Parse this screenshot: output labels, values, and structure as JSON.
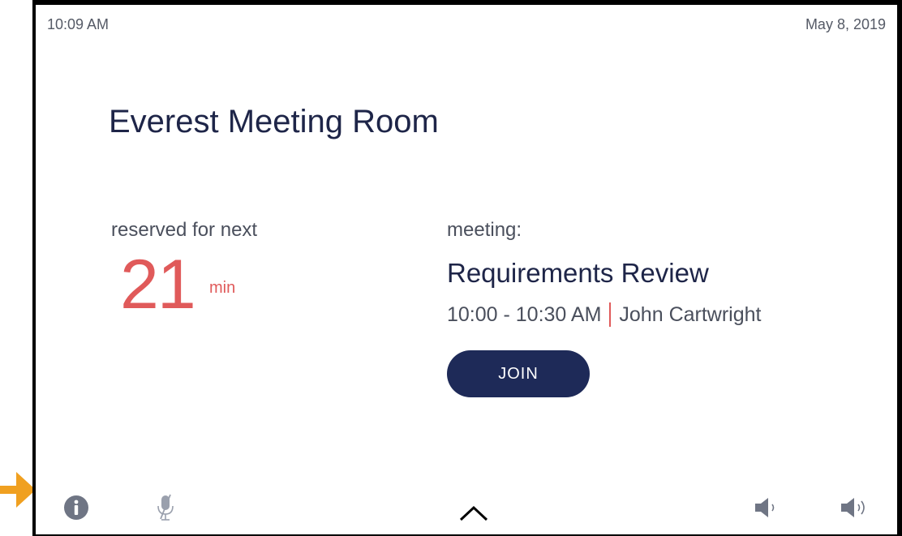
{
  "status_bar": {
    "time": "10:09 AM",
    "date": "May 8, 2019"
  },
  "room": {
    "title": "Everest Meeting Room"
  },
  "reservation": {
    "label": "reserved for next",
    "minutes": "21",
    "unit": "min"
  },
  "meeting": {
    "label": "meeting:",
    "name": "Requirements Review",
    "time_range": "10:00 - 10:30 AM",
    "organizer": "John Cartwright",
    "join_label": "JOIN"
  },
  "bottom_bar": {
    "icons": [
      "info-icon",
      "mic-muted-icon",
      "chevron-up-icon",
      "volume-down-icon",
      "volume-up-icon"
    ]
  },
  "colors": {
    "accent_navy": "#1e2a58",
    "accent_red": "#e05a5a",
    "pointer_orange": "#f0a020",
    "frame": "#000000"
  }
}
